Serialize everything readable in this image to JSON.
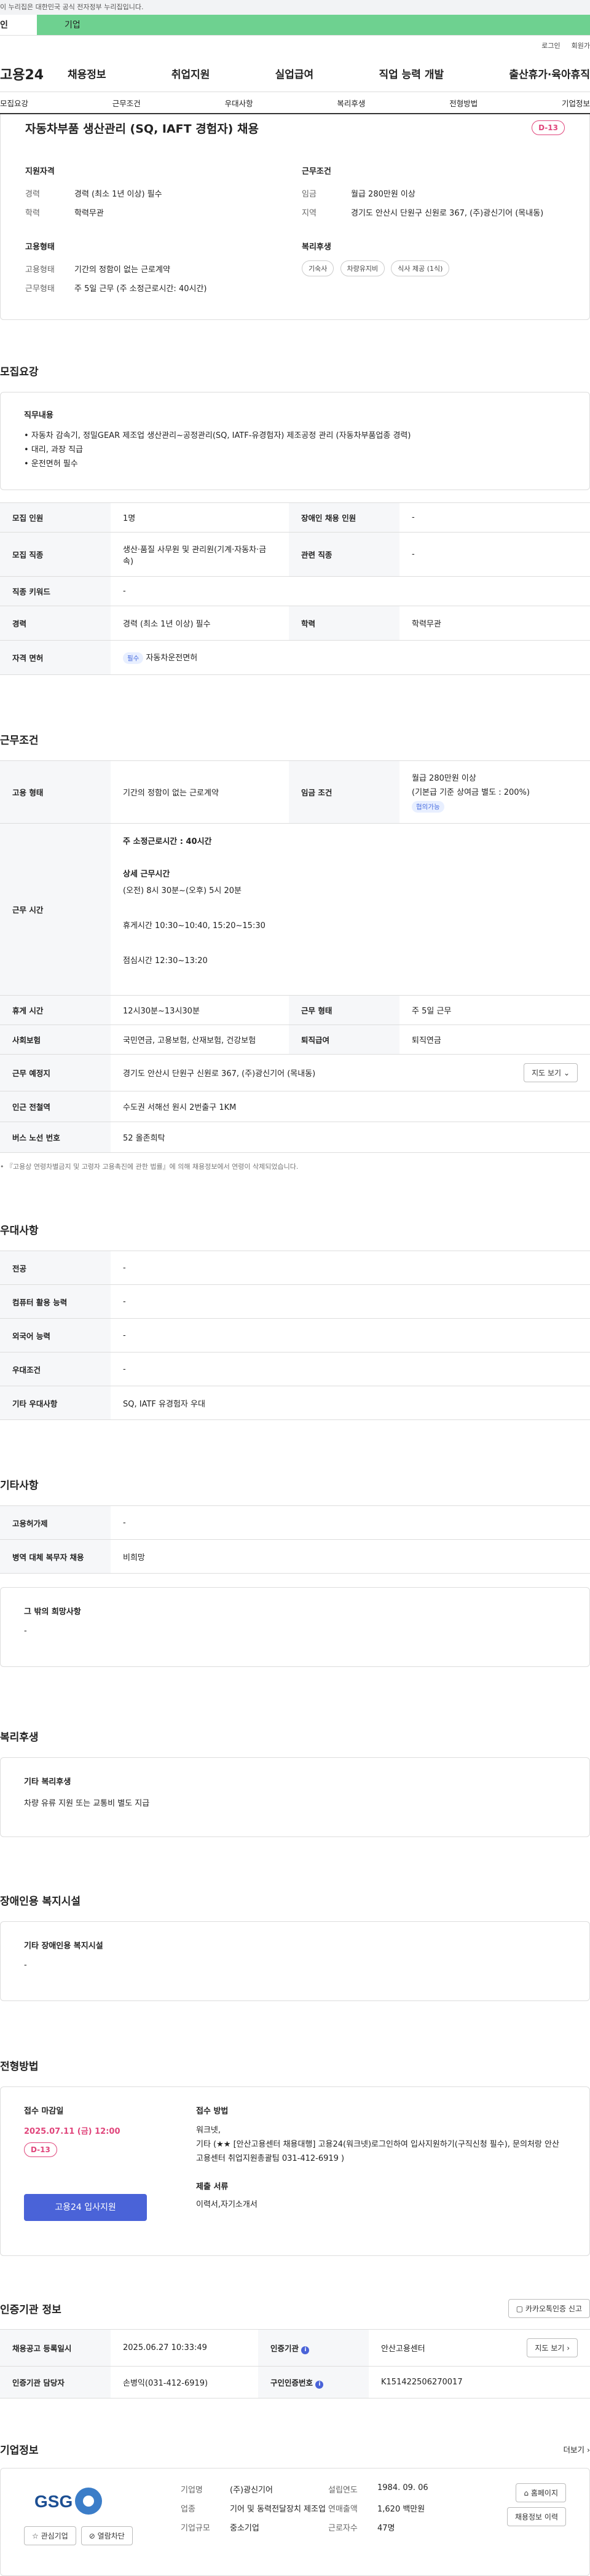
{
  "topbar": {
    "notice": "이 누리집은 대한민국 공식 전자정부 누리집입니다."
  },
  "gnb": {
    "tab_personal": "인",
    "tab_company": "기업"
  },
  "util": {
    "login": "로그인",
    "join": "회원가"
  },
  "logo": "고용24",
  "menu": [
    "채용정보",
    "취업지원",
    "실업급여",
    "직업 능력 개발",
    "출산휴가·육아휴직"
  ],
  "subnav": [
    "모집요강",
    "근무조건",
    "우대사항",
    "복리후생",
    "전형방법",
    "기업정보"
  ],
  "job": {
    "title": "자동차부품 생산관리 (SQ, IAFT 경험자) 채용",
    "dday": "D-13"
  },
  "summary": {
    "qual_title": "지원자격",
    "qual": [
      {
        "k": "경력",
        "v": "경력 (최소 1년 이상) 필수"
      },
      {
        "k": "학력",
        "v": "학력무관"
      }
    ],
    "cond_title": "근무조건",
    "cond": [
      {
        "k": "임금",
        "v": "월급 280만원 이상"
      },
      {
        "k": "지역",
        "v": "경기도 안산시 단원구 신원로 367, (주)광신기어 (목내동)"
      }
    ],
    "emp_title": "고용형태",
    "emp": [
      {
        "k": "고용형태",
        "v": "기간의 정함이 없는 근로계약"
      },
      {
        "k": "근무형태",
        "v": "주 5일 근무 (주 소정근로시간: 40시간)"
      }
    ],
    "welfare_title": "복리후생",
    "welfare_tags": [
      "기숙사",
      "차량유지비",
      "식사 제공 (1식)"
    ]
  },
  "recruit": {
    "heading": "모집요강",
    "duty_title": "직무내용",
    "duties": [
      "자동차 감속기, 정밀GEAR 제조업 생산관리~공정관리(SQ, IATF-유경험자) 제조공정 관리 (자동차부품업종 경력)",
      "대리, 과장 직급",
      "운전면허 필수"
    ],
    "rows": [
      {
        "k": "모집 인원",
        "v": "1명",
        "k2": "장애인 채용 인원",
        "v2": "-"
      },
      {
        "k": "모집 직종",
        "v": "생산·품질 사무원 및 관리원(기계·자동차·금속)",
        "k2": "관련 직종",
        "v2": "-"
      },
      {
        "k": "직종 키워드",
        "v": "-"
      },
      {
        "k": "경력",
        "v": "경력 (최소 1년 이상) 필수",
        "k2": "학력",
        "v2": "학력무관"
      },
      {
        "k": "자격 면허",
        "badge": "필수",
        "v": "자동차운전면허"
      }
    ]
  },
  "work": {
    "heading": "근무조건",
    "emp_k": "고용 형태",
    "emp_v": "기간의 정함이 없는 근로계약",
    "wage_k": "임금 조건",
    "wage_v": "월급 280만원 이상",
    "wage_note": "(기본급 기준 상여금 별도 : 200%)",
    "wage_badge": "협의가능",
    "time_k": "근무 시간",
    "time_total": "주 소정근로시간 : 40시간",
    "time_detail_title": "상세 근무시간",
    "time_detail": "(오전) 8시 30분~(오후) 5시 20분",
    "rest": "휴게시간 10:30~10:40, 15:20~15:30",
    "lunch": "점심시간 12:30~13:20",
    "break_k": "휴게 시간",
    "break_v": "12시30분~13시30분",
    "form_k": "근무 형태",
    "form_v": "주 5일 근무",
    "ins_k": "사회보험",
    "ins_v": "국민연금, 고용보험, 산재보험, 건강보험",
    "ret_k": "퇴직급여",
    "ret_v": "퇴직연금",
    "loc_k": "근무 예정지",
    "loc_v": "경기도 안산시 단원구 신원로 367, (주)광신기어 (목내동)",
    "map_btn": "지도 보기",
    "subway_k": "인근 전철역",
    "subway_v": "수도권 서해선 원시 2번출구 1KM",
    "bus_k": "버스 노선 번호",
    "bus_v": "52 올존희탁",
    "footnote": "『고용상 연령차별금지 및 고령자 고용촉진에 관한 법률』에 의해 채용정보에서 연령이 삭제되었습니다."
  },
  "pref": {
    "heading": "우대사항",
    "rows": [
      {
        "k": "전공",
        "v": "-"
      },
      {
        "k": "컴퓨터 활용 능력",
        "v": "-"
      },
      {
        "k": "외국어 능력",
        "v": "-"
      },
      {
        "k": "우대조건",
        "v": "-"
      },
      {
        "k": "기타 우대사항",
        "v": "SQ, IATF 유경험자 우대"
      }
    ]
  },
  "etc": {
    "heading": "기타사항",
    "rows": [
      {
        "k": "고용허가제",
        "v": "-"
      },
      {
        "k": "병역 대체 복무자 채용",
        "v": "비희망"
      }
    ],
    "other_title": "그 밖의 희망사항",
    "other_v": "-"
  },
  "welfare": {
    "heading": "복리후생",
    "title": "기타 복리후생",
    "v": "차량 유류 지원 또는 교통비 별도 지급"
  },
  "disabled": {
    "heading": "장애인용 복지시설",
    "title": "기타 장애인용 복지시설",
    "v": "-"
  },
  "process": {
    "heading": "전형방법",
    "deadline_title": "접수 마감일",
    "deadline": "2025.07.11 (금) 12:00",
    "dday": "D-13",
    "apply_btn": "고용24 입사지원",
    "method_title": "접수 방법",
    "method_v1": "워크넷,",
    "method_v2": "기타 (★★ [안산고용센터 채용대행] 고용24(워크넷)로그인하여 입사지원하기(구직신청 필수), 문의처랑 안산고용센터 취업지원총괄팀 031-412-6919 )",
    "docs_title": "제출 서류",
    "docs_v": "이력서,자기소개서"
  },
  "cert": {
    "heading": "인증기관 정보",
    "share_btn": "카카오톡인증 신고",
    "rows": [
      {
        "k": "채용공고 등록일시",
        "v": "2025.06.27 10:33:49",
        "k2": "인증기관",
        "v2": "안산고용센터",
        "btn": "지도 보기"
      },
      {
        "k": "인증기관 담당자",
        "v": "손병익(031-412-6919)",
        "k2": "구인인증번호",
        "v2": "K151422506270017"
      }
    ]
  },
  "company": {
    "heading": "기업정보",
    "more": "더보기",
    "logo_text": "GSG",
    "fav_btn": "관심기업",
    "block_btn": "열람차단",
    "info": [
      {
        "k": "기업명",
        "v": "(주)광신기어",
        "k2": "설립연도",
        "v2": "1984. 09. 06"
      },
      {
        "k": "업종",
        "v": "기어 및 동력전달장치 제조업",
        "k2": "연매출액",
        "v2": "1,620 백만원"
      },
      {
        "k": "기업규모",
        "v": "중소기업",
        "k2": "근로자수",
        "v2": "47명"
      }
    ],
    "home_btn": "홈페이지",
    "jobs_btn": "채용정보 이력"
  },
  "colors": {
    "accent": "#4a63d8",
    "dday": "#e0457b",
    "gnb_green": "#6ed190"
  }
}
